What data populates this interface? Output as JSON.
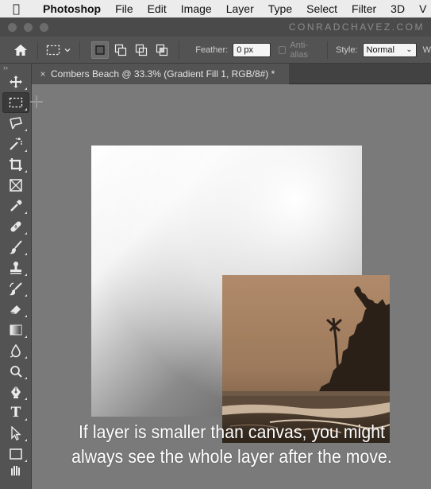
{
  "menubar": {
    "apple_icon": "apple-icon",
    "app_name": "Photoshop",
    "items": [
      "File",
      "Edit",
      "Image",
      "Layer",
      "Type",
      "Select",
      "Filter",
      "3D",
      "V"
    ]
  },
  "window": {
    "watermark": "CONRADCHAVEZ.COM"
  },
  "options_bar": {
    "home_icon": "home-icon",
    "marquee_icon": "rect-marquee-icon",
    "modes": [
      "new-selection-icon",
      "add-selection-icon",
      "subtract-selection-icon",
      "intersect-selection-icon"
    ],
    "feather_label": "Feather:",
    "feather_value": "0 px",
    "antialias_label": "Anti-alias",
    "style_label": "Style:",
    "style_value": "Normal",
    "width_label": "W"
  },
  "tools": [
    {
      "name": "move-tool",
      "icon": "move-icon"
    },
    {
      "name": "rectangular-marquee-tool",
      "icon": "marquee-icon",
      "active": true
    },
    {
      "name": "lasso-tool",
      "icon": "lasso-icon"
    },
    {
      "name": "magic-wand-tool",
      "icon": "magic-wand-icon"
    },
    {
      "name": "crop-tool",
      "icon": "crop-icon"
    },
    {
      "name": "frame-tool",
      "icon": "frame-icon"
    },
    {
      "name": "eyedropper-tool",
      "icon": "eyedropper-icon"
    },
    {
      "name": "healing-brush-tool",
      "icon": "bandage-icon"
    },
    {
      "name": "brush-tool",
      "icon": "brush-icon"
    },
    {
      "name": "clone-stamp-tool",
      "icon": "stamp-icon"
    },
    {
      "name": "history-brush-tool",
      "icon": "history-brush-icon"
    },
    {
      "name": "eraser-tool",
      "icon": "eraser-icon"
    },
    {
      "name": "gradient-tool",
      "icon": "gradient-icon"
    },
    {
      "name": "blur-tool",
      "icon": "drop-icon"
    },
    {
      "name": "dodge-tool",
      "icon": "dodge-icon"
    },
    {
      "name": "pen-tool",
      "icon": "pen-icon"
    },
    {
      "name": "type-tool",
      "icon": "type-icon",
      "glyph": "T"
    },
    {
      "name": "path-selection-tool",
      "icon": "arrow-icon"
    },
    {
      "name": "rectangle-tool",
      "icon": "rectangle-icon"
    },
    {
      "name": "hand-tool",
      "icon": "hand-icon"
    }
  ],
  "document": {
    "close_glyph": "×",
    "tab_title": "Combers Beach @ 33.3% (Gradient Fill 1, RGB/8#) *"
  },
  "caption": {
    "line1": "If layer is smaller than canvas, you might",
    "line2": "always see the whole layer after the move."
  },
  "colors": {
    "menubar_bg": "#ececec",
    "panel_bg": "#535353",
    "pasteboard": "#7a7a7a",
    "photo_tone": "#a07a5a"
  }
}
